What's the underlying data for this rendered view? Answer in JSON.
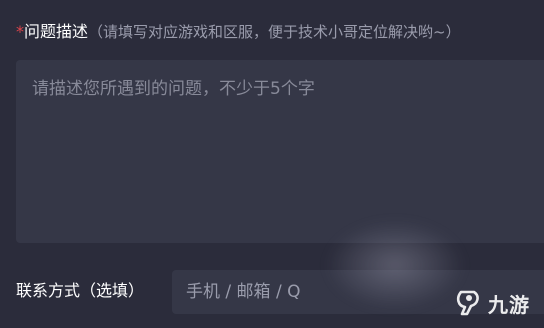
{
  "problem": {
    "required_mark": "*",
    "label": "问题描述",
    "hint": "（请填写对应游戏和区服，便于技术小哥定位解决哟~）",
    "placeholder": "请描述您所遇到的问题，不少于5个字"
  },
  "contact": {
    "label": "联系方式（选填）",
    "placeholder": "手机 / 邮箱 / Q"
  },
  "watermark": {
    "text": "九游"
  }
}
